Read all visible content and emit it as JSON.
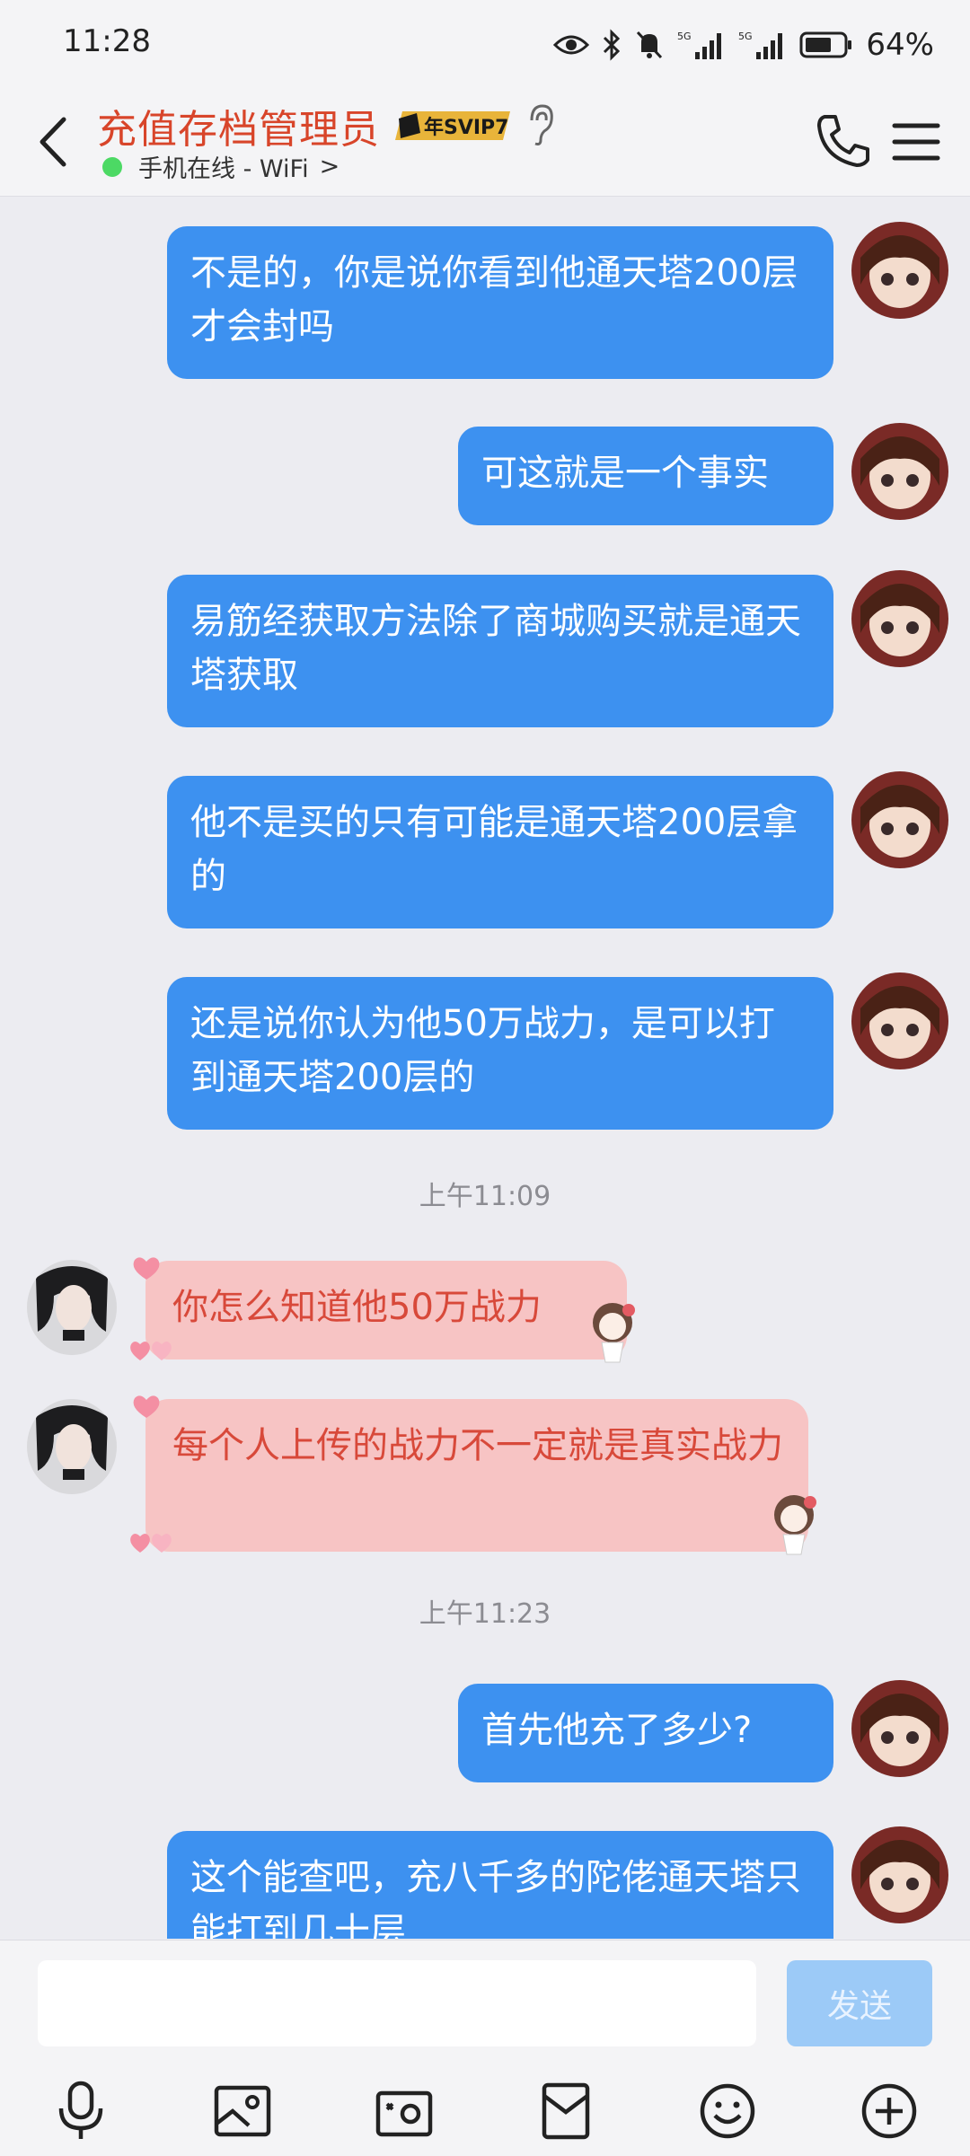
{
  "status_bar": {
    "time": "11:28",
    "battery": "64%"
  },
  "header": {
    "title": "充值存档管理员",
    "vip_badge": "年SVIP7",
    "status": "手机在线 - WiFi",
    "status_chevron": ">"
  },
  "messages": [
    {
      "side": "out",
      "text": "不是的，你是说你看到他通天塔200层才会封吗"
    },
    {
      "side": "out",
      "text": "可这就是一个事实"
    },
    {
      "side": "out",
      "text": "易筋经获取方法除了商城购买就是通天塔获取"
    },
    {
      "side": "out",
      "text": "他不是买的只有可能是通天塔200层拿的"
    },
    {
      "side": "out",
      "text": "还是说你认为他50万战力，是可以打到通天塔200层的"
    },
    {
      "side": "time",
      "text": "上午11:09"
    },
    {
      "side": "in",
      "text": "你怎么知道他50万战力"
    },
    {
      "side": "in",
      "text": "每个人上传的战力不一定就是真实战力"
    },
    {
      "side": "time",
      "text": "上午11:23"
    },
    {
      "side": "out",
      "text": "首先他充了多少?"
    },
    {
      "side": "out",
      "text": "这个能查吧，充八千多的陀佬通天塔只能打到几十层"
    }
  ],
  "input": {
    "placeholder": "",
    "send_label": "发送"
  },
  "toolbar": [
    "mic-icon",
    "image-icon",
    "camera-icon",
    "red-packet-icon",
    "emoji-icon",
    "plus-icon"
  ]
}
